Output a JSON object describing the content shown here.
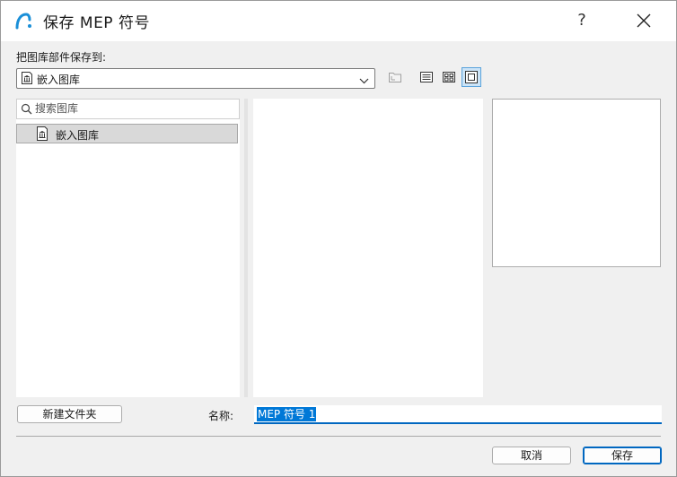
{
  "window": {
    "title": "保存 MEP 符号",
    "help_label": "?"
  },
  "save_to": {
    "label": "把图库部件保存到:",
    "selected_location": "嵌入图库"
  },
  "toolbar": {
    "icons": [
      "new-folder-icon",
      "list-view-icon",
      "thumbnail-view-icon",
      "preview-view-icon"
    ],
    "active_view": "preview-view"
  },
  "search": {
    "placeholder": "搜索图库",
    "value": ""
  },
  "tree": {
    "items": [
      {
        "label": "嵌入图库",
        "icon": "library-icon",
        "selected": true
      }
    ]
  },
  "footer": {
    "new_folder_label": "新建文件夹",
    "name_label": "名称:",
    "name_value": "MEP 符号 1",
    "cancel_label": "取消",
    "save_label": "保存"
  },
  "colors": {
    "accent": "#0067c0",
    "selection": "#0078d7",
    "active_toggle_bg": "#cce4f7"
  }
}
